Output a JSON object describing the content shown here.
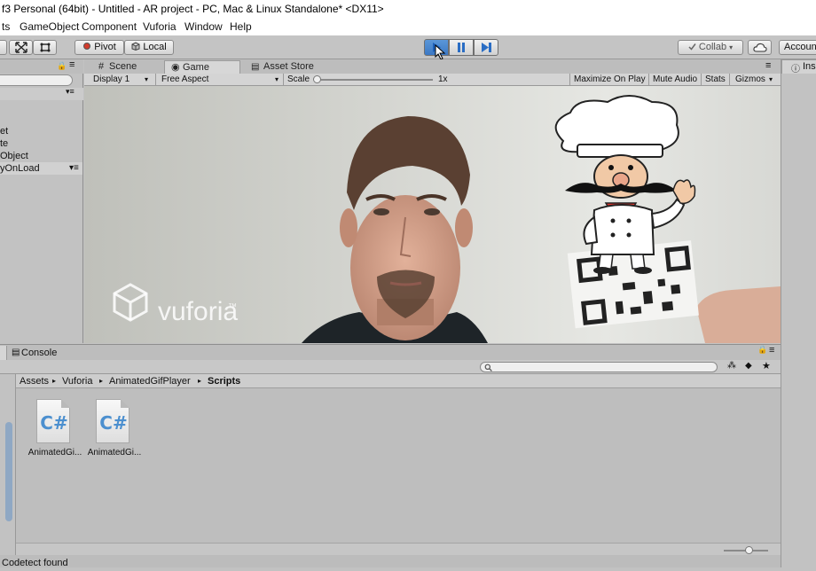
{
  "window": {
    "title": "f3 Personal (64bit) - Untitled - AR project - PC, Mac & Linux Standalone* <DX11>"
  },
  "menu": [
    "ts",
    "GameObject",
    "Component",
    "Vuforia",
    "Window",
    "Help"
  ],
  "toolbar": {
    "pivot_label": "Pivot",
    "local_label": "Local",
    "collab_label": "Collab",
    "account_label": "Accoun"
  },
  "hierarchy": {
    "items": [
      "et",
      "te",
      "Object",
      "yOnLoad"
    ]
  },
  "scene_tabs": [
    {
      "label": "Scene",
      "icon": "scene-grid-icon"
    },
    {
      "label": "Game",
      "icon": "game-icon"
    },
    {
      "label": "Asset Store",
      "icon": "store-bag-icon"
    }
  ],
  "game_toolbar": {
    "display": "Display 1",
    "aspect": "Free Aspect",
    "scale_label": "Scale",
    "scale_value": "1x",
    "maximize": "Maximize On Play",
    "mute": "Mute Audio",
    "stats": "Stats",
    "gizmos": "Gizmos"
  },
  "game_view": {
    "watermark": "vuforia",
    "trademark": "™"
  },
  "inspector": {
    "label": "Insp"
  },
  "bottom": {
    "console_tab": "Console",
    "breadcrumb": [
      "Assets",
      "Vuforia",
      "AnimatedGifPlayer",
      "Scripts"
    ],
    "assets": [
      {
        "label": "AnimatedGi...",
        "icon": "csharp-script-icon"
      },
      {
        "label": "AnimatedGi...",
        "icon": "csharp-script-icon"
      }
    ]
  },
  "status": "Codetect found",
  "colors": {
    "play_active": "#3b78c4",
    "panel_bg": "#c2c2c2",
    "csharp": "#4b8fcf"
  }
}
